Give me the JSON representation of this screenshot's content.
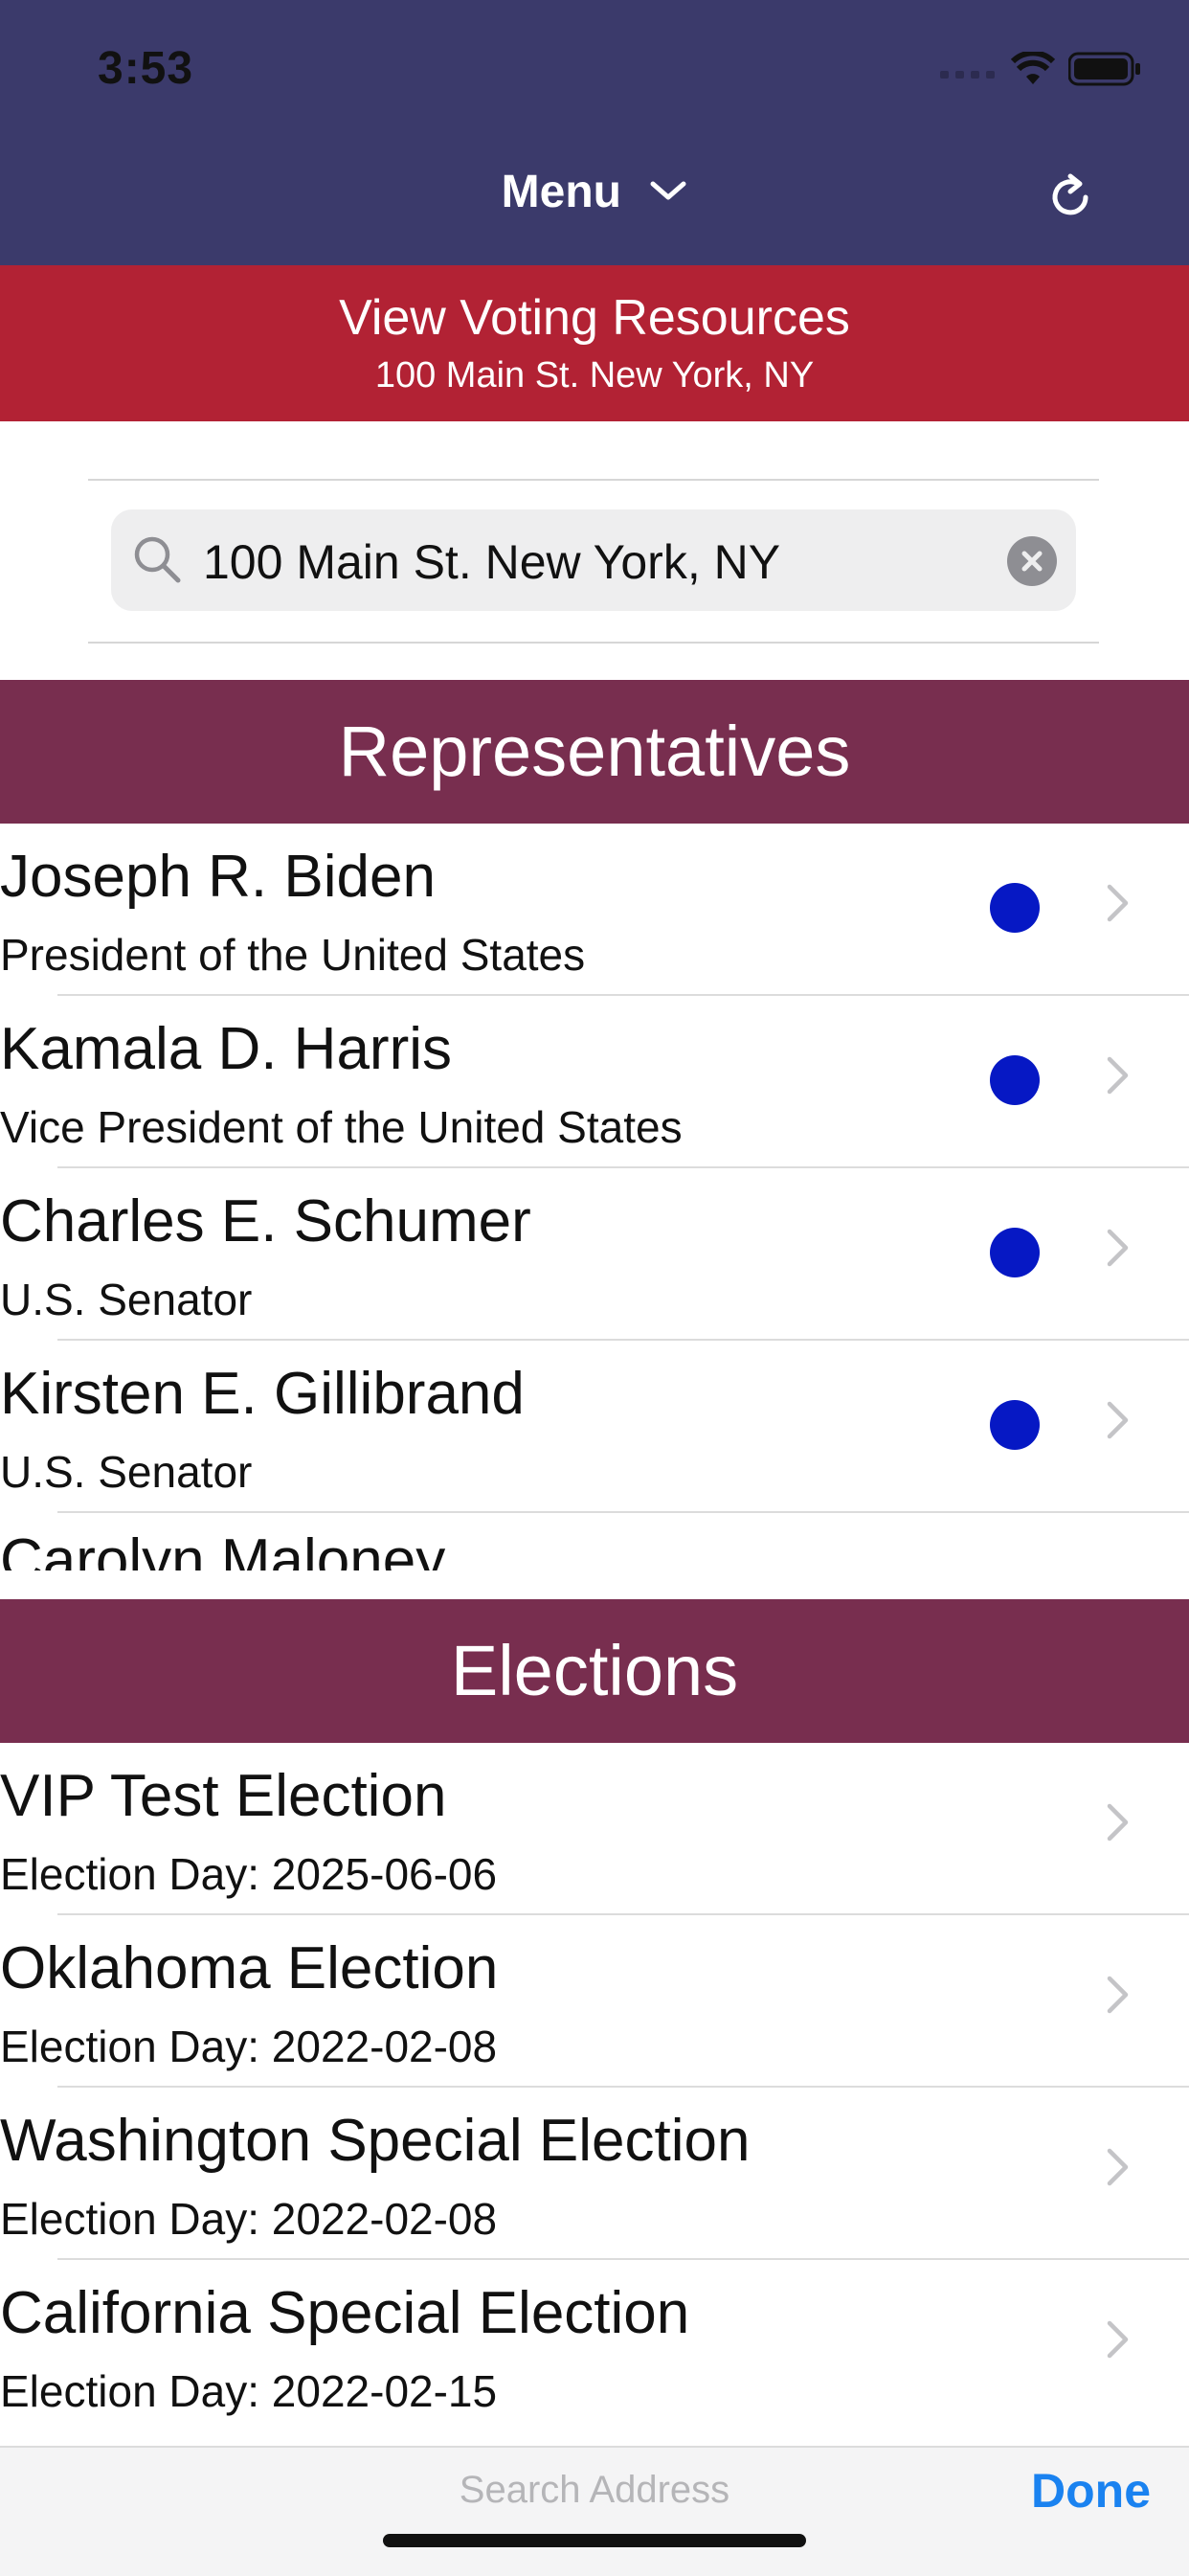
{
  "status_bar": {
    "time": "3:53"
  },
  "nav": {
    "menu_label": "Menu"
  },
  "banner": {
    "title": "View Voting Resources",
    "address": "100 Main St. New York, NY"
  },
  "search": {
    "value": "100 Main St. New York, NY"
  },
  "representatives": {
    "header": "Representatives",
    "items": [
      {
        "name": "Joseph R. Biden",
        "office": "President of the United States"
      },
      {
        "name": "Kamala D. Harris",
        "office": "Vice President of the United States"
      },
      {
        "name": "Charles E. Schumer",
        "office": "U.S. Senator"
      },
      {
        "name": "Kirsten E. Gillibrand",
        "office": "U.S. Senator"
      }
    ],
    "partial_name": "Carolyn Maloney",
    "party_dot_color": "#0618c4"
  },
  "elections": {
    "header": "Elections",
    "items": [
      {
        "name": "VIP Test Election",
        "date": "Election Day: 2025-06-06"
      },
      {
        "name": "Oklahoma Election",
        "date": "Election Day: 2022-02-08"
      },
      {
        "name": "Washington Special Election",
        "date": "Election Day: 2022-02-08"
      },
      {
        "name": "California Special Election",
        "date": "Election Day: 2022-02-15"
      }
    ]
  },
  "keyboard_accessory": {
    "placeholder": "Search Address",
    "done_label": "Done"
  },
  "colors": {
    "nav_background": "#3b3a6b",
    "banner_background": "#b22234",
    "section_header_background": "#782e4f",
    "accent": "#1a82f0"
  }
}
